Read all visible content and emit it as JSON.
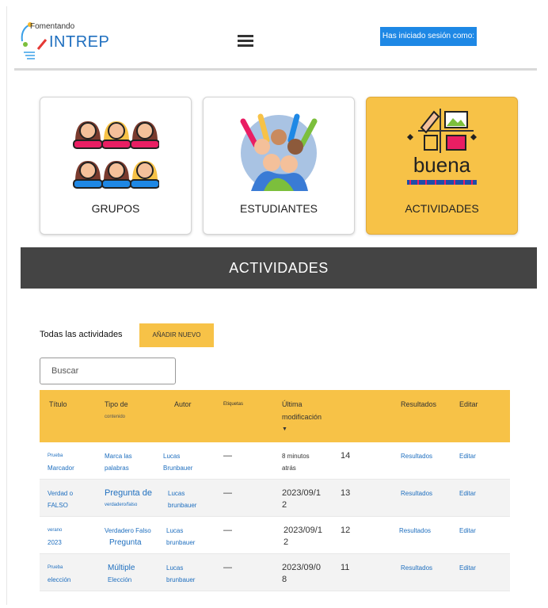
{
  "header": {
    "logo_small": "Fomentando",
    "logo_big": "INTREP",
    "session_label": "Has iniciado sesión como:"
  },
  "cards": [
    {
      "label": "GRUPOS",
      "active": false
    },
    {
      "label": "ESTUDIANTES",
      "active": false
    },
    {
      "label": "ACTIVIDADES",
      "active": true,
      "badge": "buena"
    }
  ],
  "banner_title": "ACTIVIDADES",
  "toolbar": {
    "all_label": "Todas las actividades",
    "add_label": "AÑADIR NUEVO",
    "search_placeholder": "Buscar"
  },
  "table": {
    "headers": {
      "title": "Título",
      "type_line1": "Tipo de",
      "type_line2": "contenido",
      "author": "Autor",
      "tags": "Etiquetas",
      "modified_line1": "Última",
      "modified_line2": "modificación",
      "modified_arrow": "▼",
      "id": "",
      "results": "Resultados",
      "edit": "Editar"
    },
    "rows": [
      {
        "title1": "Prueba",
        "title2": "Marcador",
        "type1": "Marca las",
        "type2": "palabras",
        "author1": "Lucas",
        "author2": "Brunbauer",
        "tags": "—",
        "mod1": "8 minutos",
        "mod2": "atrás",
        "id": "14",
        "results": "Resultados",
        "edit": "Editar"
      },
      {
        "title1": "Verdad o",
        "title2": "FALSO",
        "type1": "Pregunta de",
        "type2": "verdadero/falso",
        "author1": "Lucas",
        "author2": "brunbauer",
        "tags": "—",
        "mod1": "2023/09/1",
        "mod2": "2",
        "id": "13",
        "results": "Resultados",
        "edit": "Editar"
      },
      {
        "title1": "verano",
        "title2": "2023",
        "type1": "Verdadero Falso",
        "type2": "Pregunta",
        "author1": "Lucas",
        "author2": "brunbauer",
        "tags": "—",
        "mod1": "2023/09/1",
        "mod2": "2",
        "id": "12",
        "results": "Resultados",
        "edit": "Editar"
      },
      {
        "title1": "Prueba",
        "title2": "elección",
        "type1": "Múltiple",
        "type2": "Elección",
        "author1": "Lucas",
        "author2": "brunbauer",
        "tags": "—",
        "mod1": "2023/09/0",
        "mod2": "8",
        "id": "11",
        "results": "Resultados",
        "edit": "Editar"
      }
    ]
  },
  "colors": {
    "accent": "#f7c247",
    "banner": "#444444",
    "link": "#1f6fbf",
    "session": "#1e88e5"
  }
}
